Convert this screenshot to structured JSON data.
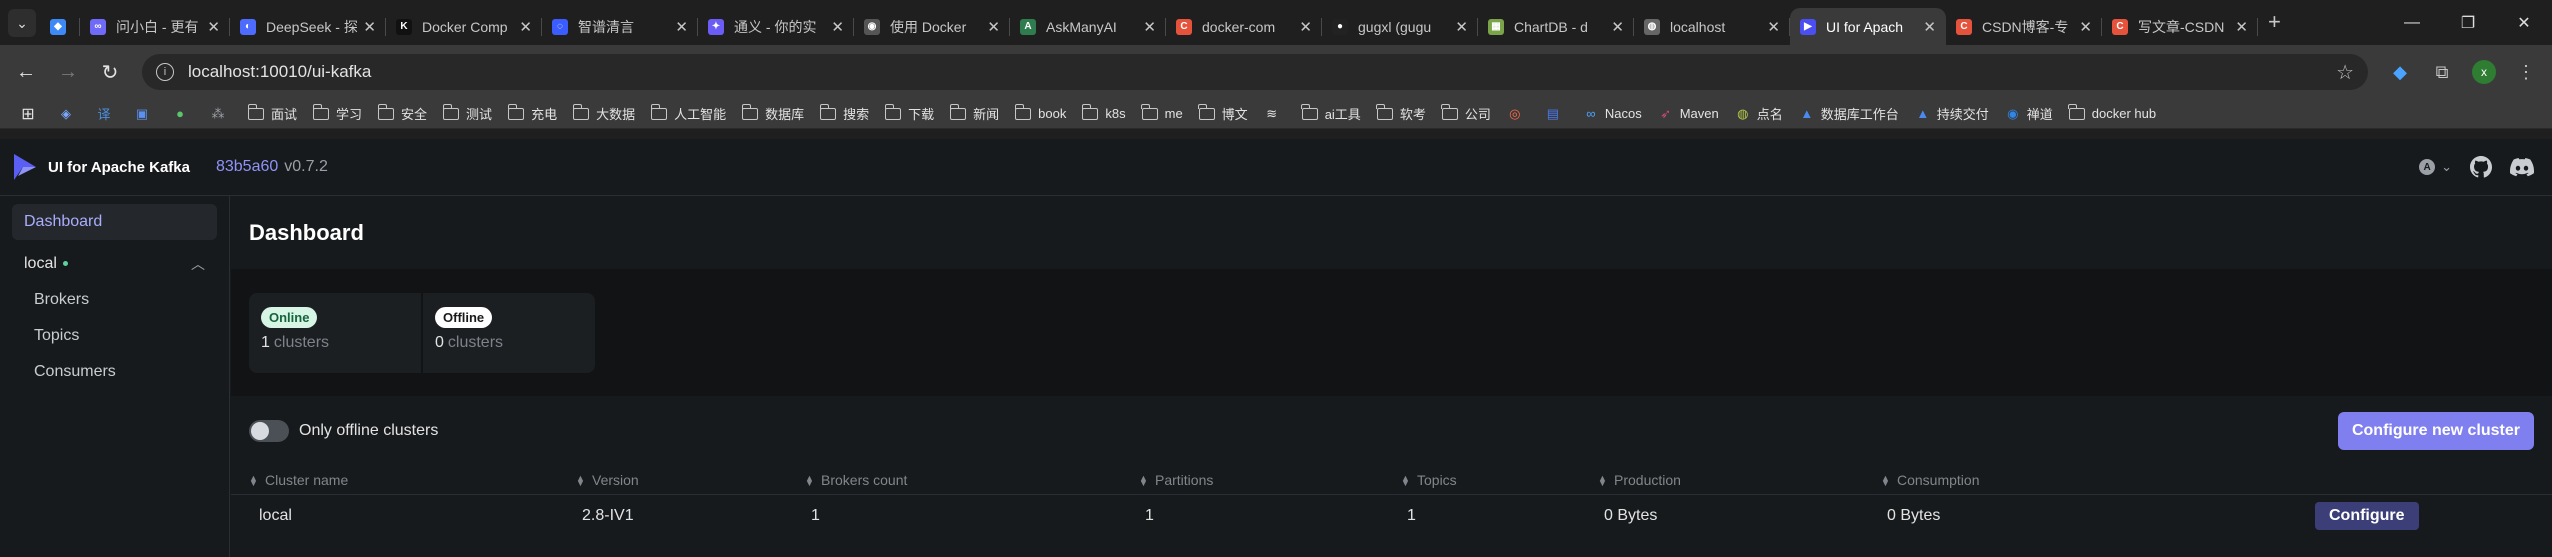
{
  "browser": {
    "tabs": [
      {
        "title": "",
        "color": "#3d8af7",
        "glyph": "◆",
        "active": false,
        "width": 40
      },
      {
        "title": "问小白 - 更有",
        "color": "#6f6af8",
        "glyph": "∞",
        "active": false,
        "width": 150
      },
      {
        "title": "DeepSeek - 探",
        "color": "#4d6bfe",
        "glyph": "◐",
        "active": false,
        "width": 156
      },
      {
        "title": "Docker Comp",
        "color": "#111111",
        "glyph": "K",
        "active": false,
        "width": 156
      },
      {
        "title": "智谱清言",
        "color": "#3b5cff",
        "glyph": "◌",
        "active": false,
        "width": 156
      },
      {
        "title": "通义 - 你的实",
        "color": "#6b5cf6",
        "glyph": "✦",
        "active": false,
        "width": 156
      },
      {
        "title": "使用 Docker",
        "color": "#555555",
        "glyph": "◉",
        "active": false,
        "width": 156
      },
      {
        "title": "AskManyAI",
        "color": "#2f7d4f",
        "glyph": "A",
        "active": false,
        "width": 156
      },
      {
        "title": "docker-com",
        "color": "#e5533d",
        "glyph": "C",
        "active": false,
        "width": 156
      },
      {
        "title": "gugxl (gugu",
        "color": "#222222",
        "glyph": "●",
        "active": false,
        "width": 156
      },
      {
        "title": "ChartDB - d",
        "color": "#7aa34a",
        "glyph": "▦",
        "active": false,
        "width": 156
      },
      {
        "title": "localhost",
        "color": "#666666",
        "glyph": "◍",
        "active": false,
        "width": 156
      },
      {
        "title": "UI for Apach",
        "color": "#4b4ef0",
        "glyph": "▶",
        "active": true,
        "width": 156
      },
      {
        "title": "CSDN博客-专",
        "color": "#e5533d",
        "glyph": "C",
        "active": false,
        "width": 156
      },
      {
        "title": "写文章-CSDN",
        "color": "#e5533d",
        "glyph": "C",
        "active": false,
        "width": 156
      }
    ],
    "url": "localhost:10010/ui-kafka",
    "avatar_letter": "x",
    "bookmarks": [
      {
        "label": "",
        "type": "apps"
      },
      {
        "label": "",
        "type": "icon",
        "glyph": "◈",
        "color": "#7aa7ff"
      },
      {
        "label": "",
        "type": "icon",
        "glyph": "译",
        "color": "#4a90e2"
      },
      {
        "label": "",
        "type": "icon",
        "glyph": "▣",
        "color": "#5b8ff0"
      },
      {
        "label": "",
        "type": "icon",
        "glyph": "●",
        "color": "#5cc56a"
      },
      {
        "label": "",
        "type": "icon",
        "glyph": "⁂",
        "color": "#9aa0a6"
      },
      {
        "label": "面试",
        "type": "folder"
      },
      {
        "label": "学习",
        "type": "folder"
      },
      {
        "label": "安全",
        "type": "folder"
      },
      {
        "label": "测试",
        "type": "folder"
      },
      {
        "label": "充电",
        "type": "folder"
      },
      {
        "label": "大数据",
        "type": "folder"
      },
      {
        "label": "人工智能",
        "type": "folder"
      },
      {
        "label": "数据库",
        "type": "folder"
      },
      {
        "label": "搜索",
        "type": "folder"
      },
      {
        "label": "下载",
        "type": "folder"
      },
      {
        "label": "新闻",
        "type": "folder"
      },
      {
        "label": "book",
        "type": "folder"
      },
      {
        "label": "k8s",
        "type": "folder"
      },
      {
        "label": "me",
        "type": "folder"
      },
      {
        "label": "博文",
        "type": "folder"
      },
      {
        "label": "",
        "type": "icon",
        "glyph": "≋",
        "color": "#e3e3e3"
      },
      {
        "label": "ai工具",
        "type": "folder"
      },
      {
        "label": "软考",
        "type": "folder"
      },
      {
        "label": "公司",
        "type": "folder"
      },
      {
        "label": "",
        "type": "icon",
        "glyph": "◎",
        "color": "#ff6b4a"
      },
      {
        "label": "",
        "type": "icon",
        "glyph": "▤",
        "color": "#4a7af0"
      },
      {
        "label": "Nacos",
        "type": "icon",
        "glyph": "∞",
        "color": "#4aa3ff"
      },
      {
        "label": "Maven",
        "type": "icon",
        "glyph": "➶",
        "color": "#d04a7a"
      },
      {
        "label": "点名",
        "type": "icon",
        "glyph": "◍",
        "color": "#b8c94a"
      },
      {
        "label": "数据库工作台",
        "type": "icon",
        "glyph": "▲",
        "color": "#4a8af0"
      },
      {
        "label": "持续交付",
        "type": "icon",
        "glyph": "▲",
        "color": "#4a8af0"
      },
      {
        "label": "禅道",
        "type": "icon",
        "glyph": "◉",
        "color": "#2f86e6"
      },
      {
        "label": "docker hub",
        "type": "folder"
      }
    ]
  },
  "app": {
    "name": "UI for Apache Kafka",
    "commit": "83b5a60",
    "version": "v0.7.2",
    "sidebar": {
      "dashboard": "Dashboard",
      "cluster": "local",
      "items": [
        "Brokers",
        "Topics",
        "Consumers"
      ]
    },
    "page_title": "Dashboard",
    "metrics": {
      "online_badge": "Online",
      "online_count": "1",
      "online_unit": "clusters",
      "offline_badge": "Offline",
      "offline_count": "0",
      "offline_unit": "clusters"
    },
    "toggle_label": "Only offline clusters",
    "configure_new_label": "Configure new cluster",
    "table": {
      "headers": [
        "Cluster name",
        "Version",
        "Brokers count",
        "Partitions",
        "Topics",
        "Production",
        "Consumption"
      ],
      "rows": [
        {
          "name": "local",
          "version": "2.8-IV1",
          "brokers": "1",
          "partitions": "1",
          "topics": "1",
          "production": "0 Bytes",
          "consumption": "0 Bytes",
          "action": "Configure"
        }
      ]
    }
  }
}
